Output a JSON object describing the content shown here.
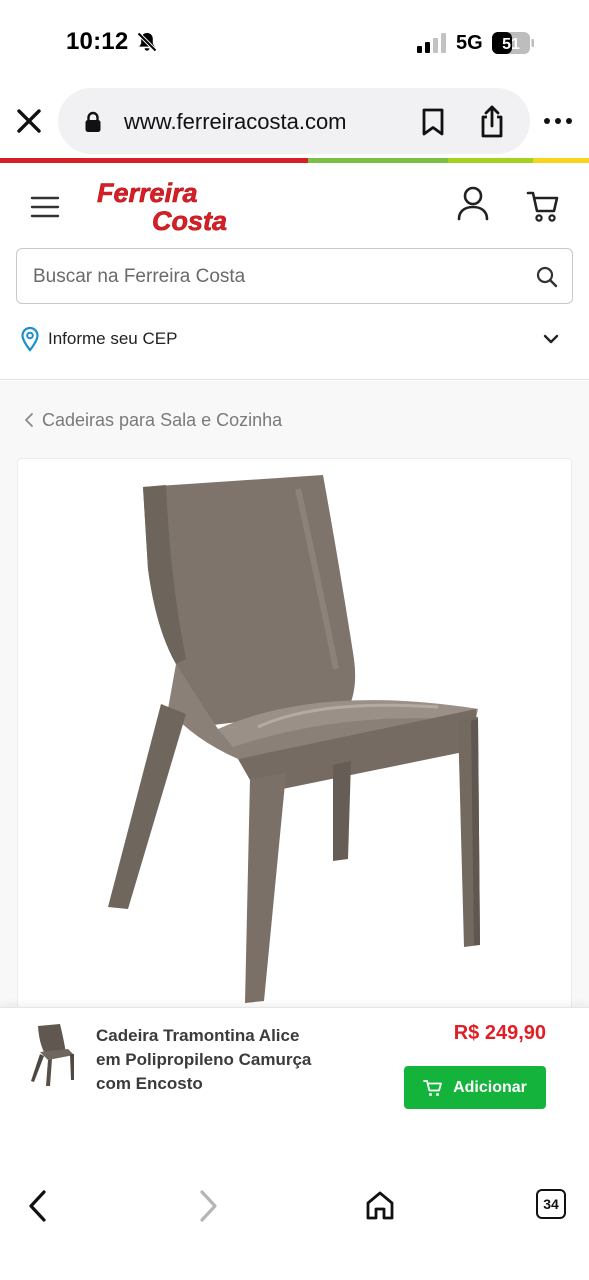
{
  "status_bar": {
    "time": "10:12",
    "network": "5G",
    "battery": "51"
  },
  "browser": {
    "url": "www.ferreiracosta.com",
    "tab_count": "34"
  },
  "brand": {
    "logo_line1": "Ferreira",
    "logo_line2": "Costa",
    "colors": {
      "red": "#d71f26",
      "green": "#7bc043",
      "lime": "#a3d31f",
      "yellow": "#f7d51d",
      "price_red": "#e01e25",
      "button_green": "#14b33c",
      "cep_pin_blue": "#1a8fd1",
      "chair_taupe": "#7d736a"
    }
  },
  "header": {
    "search_placeholder": "Buscar na Ferreira Costa",
    "cep_label": "Informe seu CEP"
  },
  "breadcrumb": {
    "label": "Cadeiras para Sala e Cozinha"
  },
  "product": {
    "name": "Cadeira Tramontina Alice em Polipropileno Camurça com Encosto",
    "price": "R$ 249,90",
    "add_label": "Adicionar"
  }
}
